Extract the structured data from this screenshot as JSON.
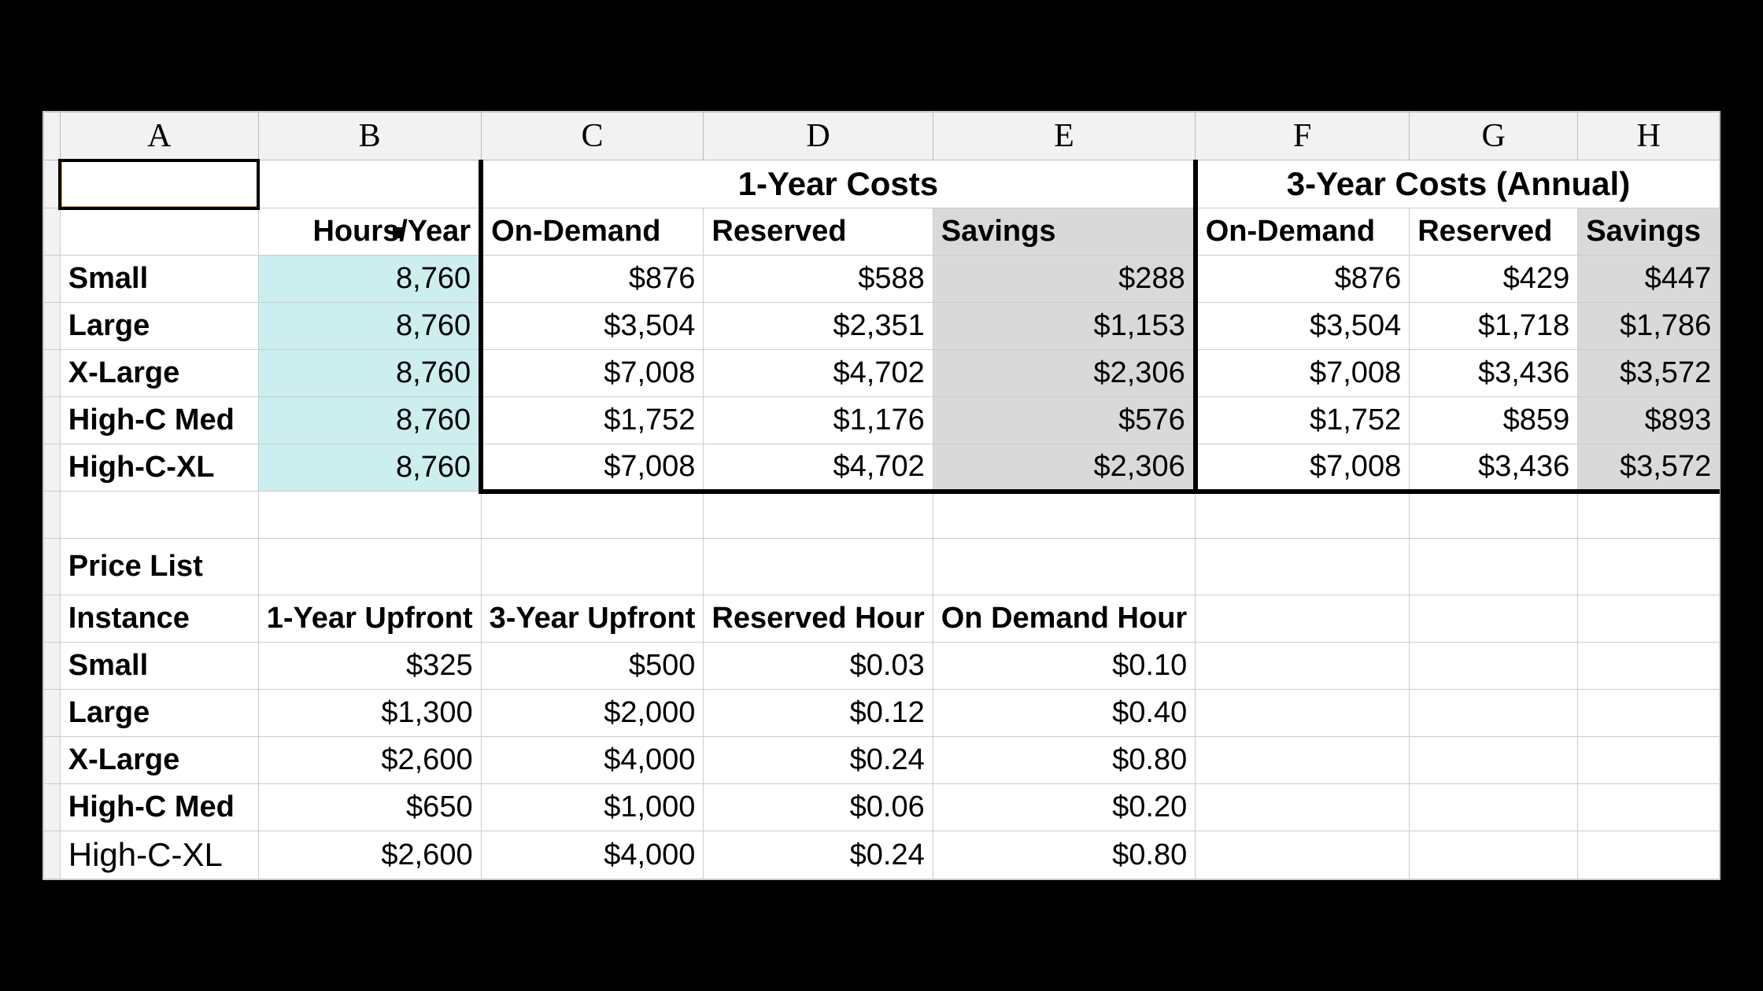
{
  "columns": [
    "A",
    "B",
    "C",
    "D",
    "E",
    "F",
    "G",
    "H"
  ],
  "group_headers": {
    "one_year": "1-Year Costs",
    "three_year": "3-Year Costs (Annual)"
  },
  "sub_headers": {
    "hours": "Hours/Year",
    "ondemand": "On-Demand",
    "reserved": "Reserved",
    "savings": "Savings"
  },
  "cost_rows": [
    {
      "name": "Small",
      "hours": "8,760",
      "od1": "$876",
      "r1": "$588",
      "s1": "$288",
      "od3": "$876",
      "r3": "$429",
      "s3": "$447"
    },
    {
      "name": "Large",
      "hours": "8,760",
      "od1": "$3,504",
      "r1": "$2,351",
      "s1": "$1,153",
      "od3": "$3,504",
      "r3": "$1,718",
      "s3": "$1,786"
    },
    {
      "name": "X-Large",
      "hours": "8,760",
      "od1": "$7,008",
      "r1": "$4,702",
      "s1": "$2,306",
      "od3": "$7,008",
      "r3": "$3,436",
      "s3": "$3,572"
    },
    {
      "name": "High-C Med",
      "hours": "8,760",
      "od1": "$1,752",
      "r1": "$1,176",
      "s1": "$576",
      "od3": "$1,752",
      "r3": "$859",
      "s3": "$893"
    },
    {
      "name": "High-C-XL",
      "hours": "8,760",
      "od1": "$7,008",
      "r1": "$4,702",
      "s1": "$2,306",
      "od3": "$7,008",
      "r3": "$3,436",
      "s3": "$3,572"
    }
  ],
  "price_list_title": "Price List",
  "price_headers": {
    "instance": "Instance",
    "upfront1": "1-Year Upfront",
    "upfront3": "3-Year Upfront",
    "reserved_hr": "Reserved Hour",
    "ondemand_hr": "On Demand Hour"
  },
  "price_rows": [
    {
      "name": "Small",
      "u1": "$325",
      "u3": "$500",
      "rh": "$0.03",
      "oh": "$0.10"
    },
    {
      "name": "Large",
      "u1": "$1,300",
      "u3": "$2,000",
      "rh": "$0.12",
      "oh": "$0.40"
    },
    {
      "name": "X-Large",
      "u1": "$2,600",
      "u3": "$4,000",
      "rh": "$0.24",
      "oh": "$0.80"
    },
    {
      "name": "High-C Med",
      "u1": "$650",
      "u3": "$1,000",
      "rh": "$0.06",
      "oh": "$0.20"
    },
    {
      "name": "High-C-XL",
      "u1": "$2,600",
      "u3": "$4,000",
      "rh": "$0.24",
      "oh": "$0.80"
    }
  ]
}
